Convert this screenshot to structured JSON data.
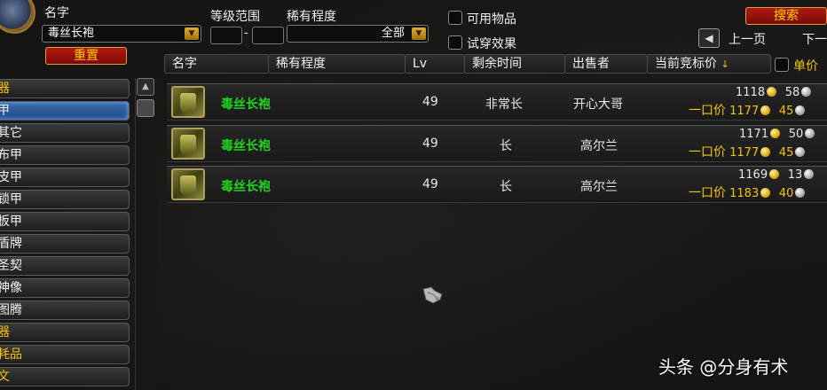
{
  "filters": {
    "name_label": "名字",
    "name_value": "毒丝长袍",
    "level_label": "等级范围",
    "level_min": "",
    "level_max": "",
    "dash": "-",
    "rarity_label": "稀有程度",
    "rarity_value": "全部",
    "usable_label": "可用物品",
    "tryon_label": "试穿效果",
    "reset_label": "重置",
    "search_label": "搜索",
    "prev_page_label": "上一页",
    "next_page_label": "下一",
    "unit_price_label": "单价"
  },
  "sidebar": {
    "items": [
      {
        "label": "器",
        "type": "cat"
      },
      {
        "label": "甲",
        "type": "selected"
      },
      {
        "label": "其它",
        "type": "sub"
      },
      {
        "label": "布甲",
        "type": "sub"
      },
      {
        "label": "皮甲",
        "type": "sub"
      },
      {
        "label": "锁甲",
        "type": "sub"
      },
      {
        "label": "板甲",
        "type": "sub"
      },
      {
        "label": "盾牌",
        "type": "sub"
      },
      {
        "label": "圣契",
        "type": "sub"
      },
      {
        "label": "神像",
        "type": "sub"
      },
      {
        "label": "图腾",
        "type": "sub"
      },
      {
        "label": "器",
        "type": "cat"
      },
      {
        "label": "耗品",
        "type": "cat"
      },
      {
        "label": "文",
        "type": "cat"
      }
    ]
  },
  "columns": {
    "name": "名字",
    "rarity": "稀有程度",
    "level": "Lv",
    "time_left": "剩余时间",
    "seller": "出售者",
    "current_bid": "当前竞标价",
    "sort_arrow": "↓"
  },
  "buyout_label": "一口价",
  "rows": [
    {
      "name": "毒丝长袍",
      "level": "49",
      "time_left": "非常长",
      "seller": "开心大哥",
      "bid_gold": "1118",
      "bid_silver": "58",
      "buy_gold": "1177",
      "buy_silver": "45"
    },
    {
      "name": "毒丝长袍",
      "level": "49",
      "time_left": "长",
      "seller": "高尔兰",
      "bid_gold": "1171",
      "bid_silver": "50",
      "buy_gold": "1177",
      "buy_silver": "45"
    },
    {
      "name": "毒丝长袍",
      "level": "49",
      "time_left": "长",
      "seller": "高尔兰",
      "bid_gold": "1169",
      "bid_silver": "13",
      "buy_gold": "1183",
      "buy_silver": "40"
    }
  ],
  "watermark": "头条 @分身有术",
  "colors": {
    "accent_gold": "#f5c400",
    "item_green": "#1ed41e",
    "button_red": "#b01a10"
  }
}
